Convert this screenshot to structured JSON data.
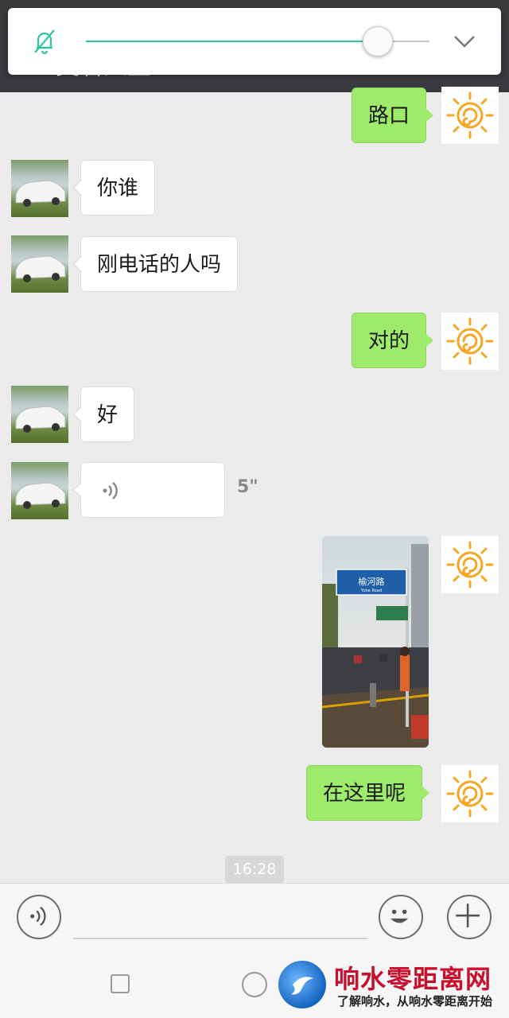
{
  "header": {
    "back_label": "<",
    "title": "美看人生",
    "more_label": "···"
  },
  "volume_panel": {
    "level_fraction": 0.85,
    "mute_icon": "bell-off-icon",
    "collapse_icon": "chevron-down-icon",
    "accent_color": "#2ec5a1"
  },
  "messages": [
    {
      "side": "out",
      "type": "text",
      "text": "路口"
    },
    {
      "side": "in",
      "type": "text",
      "text": "你谁"
    },
    {
      "side": "in",
      "type": "text",
      "text": "刚电话的人吗"
    },
    {
      "side": "out",
      "type": "text",
      "text": "对的"
    },
    {
      "side": "in",
      "type": "text",
      "text": "好"
    },
    {
      "side": "in",
      "type": "voice",
      "duration": "5\""
    },
    {
      "side": "out",
      "type": "image",
      "sign_text": "榆河路",
      "sign_sub": "Yuhe Road"
    },
    {
      "side": "out",
      "type": "text",
      "text": "在这里呢"
    }
  ],
  "timestamp": "16:28",
  "input_bar": {
    "voice_icon": "voice-icon",
    "emoji_icon": "emoji-icon",
    "plus_icon": "plus-icon"
  },
  "watermark": {
    "title": "响水零距离网",
    "slogan": "了解响水，从响水零距离开始"
  },
  "colors": {
    "out_bubble": "#9eea6a",
    "in_bubble": "#ffffff",
    "nav_bar": "#393a3f"
  }
}
